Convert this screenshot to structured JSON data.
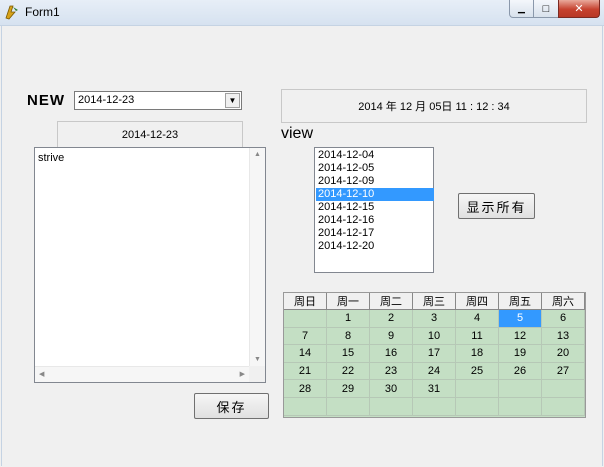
{
  "window": {
    "title": "Form1",
    "minimize_glyph": "▁",
    "maximize_glyph": "□",
    "close_glyph": "✕"
  },
  "new_label": "NEW",
  "date_combo": {
    "value": "2014-12-23",
    "arrow_glyph": "▼"
  },
  "datetime_display": "2014 年 12 月 05日   11 : 12 : 34",
  "memo_header": "2014-12-23",
  "memo_text": "strive",
  "view_label": "view",
  "date_list": {
    "items": [
      "2014-12-04",
      "2014-12-05",
      "2014-12-09",
      "2014-12-10",
      "2014-12-15",
      "2014-12-16",
      "2014-12-17",
      "2014-12-20"
    ],
    "selected": "2014-12-10"
  },
  "show_all_button": "显示所有",
  "save_button": "保存",
  "calendar": {
    "weekdays": [
      "周日",
      "周一",
      "周二",
      "周三",
      "周四",
      "周五",
      "周六"
    ],
    "weeks": [
      [
        "",
        "1",
        "2",
        "3",
        "4",
        "5",
        "6"
      ],
      [
        "7",
        "8",
        "9",
        "10",
        "11",
        "12",
        "13"
      ],
      [
        "14",
        "15",
        "16",
        "17",
        "18",
        "19",
        "20"
      ],
      [
        "21",
        "22",
        "23",
        "24",
        "25",
        "26",
        "27"
      ],
      [
        "28",
        "29",
        "30",
        "31",
        "",
        "",
        ""
      ],
      [
        "",
        "",
        "",
        "",
        "",
        "",
        ""
      ]
    ],
    "selected_day": "5",
    "cell_color": "#c4dfc4",
    "selected_color": "#3399ff"
  }
}
